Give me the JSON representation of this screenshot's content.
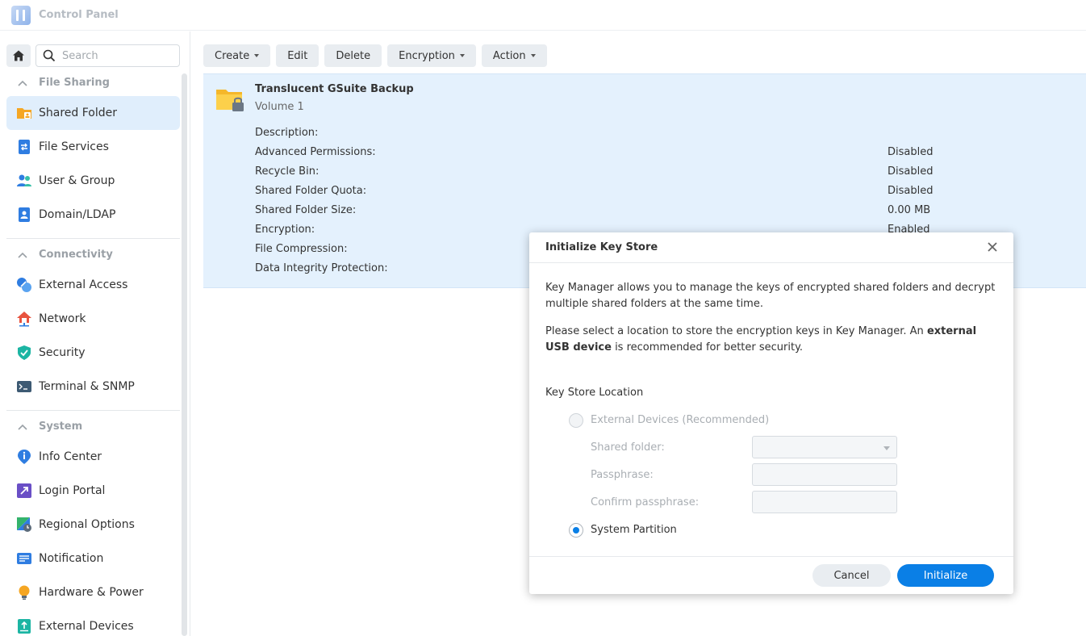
{
  "window": {
    "title": "Control Panel"
  },
  "sidebar": {
    "search_placeholder": "Search",
    "sections": [
      {
        "title": "File Sharing",
        "items": [
          "Shared Folder",
          "File Services",
          "User & Group",
          "Domain/LDAP"
        ]
      },
      {
        "title": "Connectivity",
        "items": [
          "External Access",
          "Network",
          "Security",
          "Terminal & SNMP"
        ]
      },
      {
        "title": "System",
        "items": [
          "Info Center",
          "Login Portal",
          "Regional Options",
          "Notification",
          "Hardware & Power",
          "External Devices"
        ]
      }
    ],
    "active_item": "Shared Folder"
  },
  "toolbar": {
    "create": "Create",
    "edit": "Edit",
    "delete": "Delete",
    "encryption": "Encryption",
    "action": "Action"
  },
  "folder": {
    "name": "Translucent GSuite Backup",
    "volume": "Volume 1",
    "properties": [
      {
        "label": "Description:",
        "value": ""
      },
      {
        "label": "Advanced Permissions:",
        "value": "Disabled"
      },
      {
        "label": "Recycle Bin:",
        "value": "Disabled"
      },
      {
        "label": "Shared Folder Quota:",
        "value": "Disabled"
      },
      {
        "label": "Shared Folder Size:",
        "value": "0.00 MB"
      },
      {
        "label": "Encryption:",
        "value": "Enabled"
      },
      {
        "label": "File Compression:",
        "value": ""
      },
      {
        "label": "Data Integrity Protection:",
        "value": ""
      }
    ]
  },
  "dialog": {
    "title": "Initialize Key Store",
    "para1": "Key Manager allows you to manage the keys of encrypted shared folders and decrypt multiple shared folders at the same time.",
    "para2_prefix": "Please select a location to store the encryption keys in Key Manager. An ",
    "para2_bold": "external USB device",
    "para2_suffix": " is recommended for better security.",
    "location_label": "Key Store Location",
    "option_external": "External Devices (Recommended)",
    "shared_folder_label": "Shared folder:",
    "passphrase_label": "Passphrase:",
    "confirm_label": "Confirm passphrase:",
    "option_system": "System Partition",
    "selected_option": "System Partition",
    "cancel": "Cancel",
    "initialize": "Initialize"
  },
  "colors": {
    "accent": "#0a7fe6",
    "selection": "#e4f1fd",
    "active_nav": "#e0eefc"
  }
}
